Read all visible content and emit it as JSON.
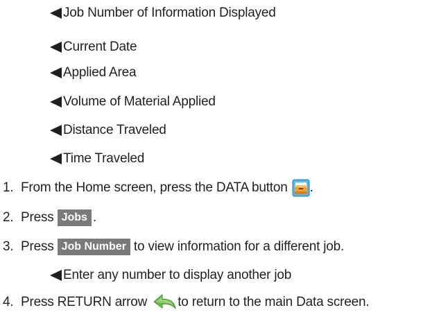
{
  "sub_items": [
    "Job Number of Information Displayed",
    "Current Date",
    "Applied Area",
    "Volume of Material Applied",
    "Distance Traveled",
    "Time Traveled"
  ],
  "steps": [
    {
      "num": "1.",
      "text_before": "From the Home screen, press the DATA button",
      "icon": "data-folder-icon",
      "text_after": "."
    },
    {
      "num": "2.",
      "text_before": "Press",
      "button": "Jobs",
      "text_after": "."
    },
    {
      "num": "3.",
      "text_before": "Press",
      "button": "Job Number",
      "text_after": "to view information for a different job."
    },
    {
      "num": "4.",
      "text_before": "Press RETURN arrow",
      "icon": "return-arrow-icon",
      "text_after": "to return to the main Data screen."
    }
  ],
  "step3_sub": "Enter any number to display another job",
  "colors": {
    "text": "#231f20",
    "button_bg": "#7a7a7a",
    "button_text": "#ffffff",
    "folder_orange": "#f0a030",
    "arrow_green": "#6cc04a"
  }
}
